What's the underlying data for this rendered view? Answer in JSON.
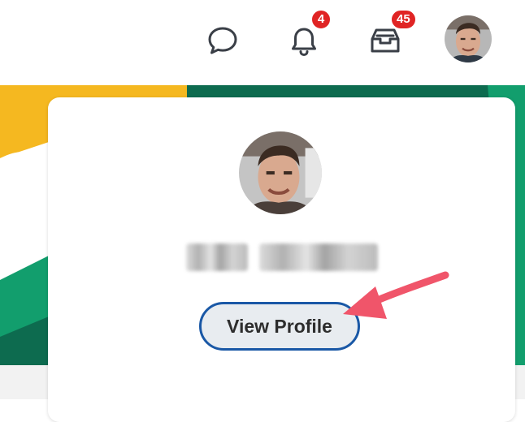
{
  "header": {
    "chat_icon": "chat-bubble-icon",
    "bell_icon": "bell-icon",
    "inbox_icon": "inbox-icon",
    "notifications_count": "4",
    "inbox_count": "45",
    "badge_color": "#e02424"
  },
  "profile_card": {
    "button_label": "View Profile",
    "button_border_color": "#1a58a6",
    "button_background": "#e8ecf0",
    "name_redacted": true
  },
  "annotation": {
    "arrow_color": "#f0556a"
  },
  "background": {
    "colors": [
      "#f5b820",
      "#129e6d",
      "#0d6b4f",
      "#ffffff"
    ]
  }
}
